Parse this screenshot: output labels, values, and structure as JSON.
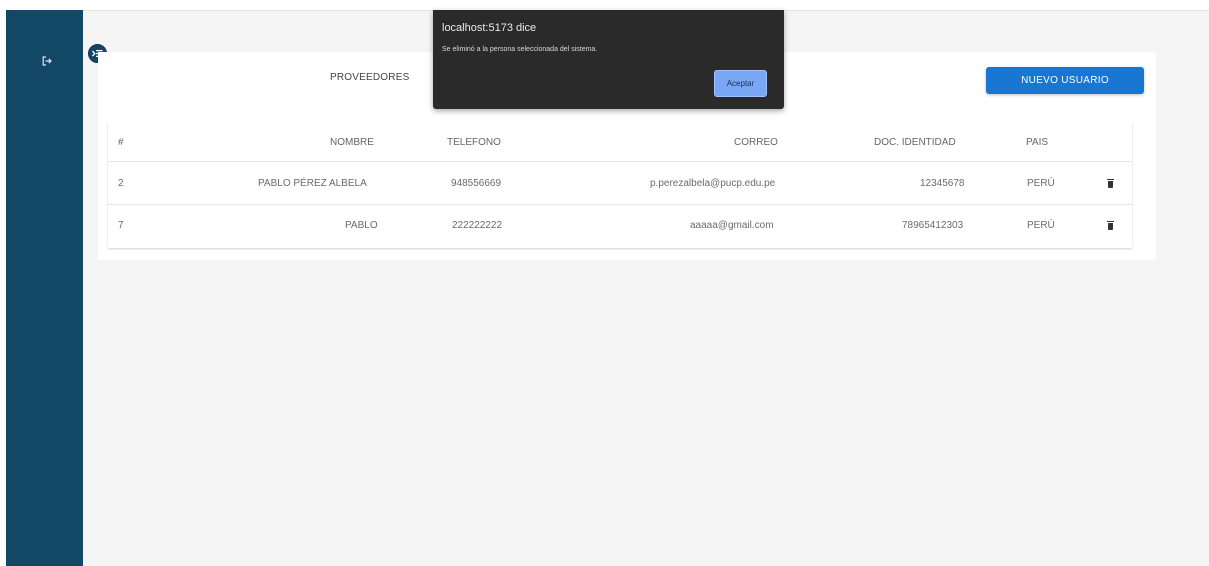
{
  "sidebar": {
    "logout_icon": "logout-icon"
  },
  "header": {
    "toggle_icon": "menu-toggle-icon",
    "tab_label": "PROVEEDORES",
    "new_user_label": "NUEVO USUARIO"
  },
  "table": {
    "headers": [
      "#",
      "NOMBRE",
      "TELEFONO",
      "CORREO",
      "DOC. IDENTIDAD",
      "PAIS"
    ],
    "rows": [
      {
        "id": "2",
        "nombre": "PABLO PÉREZ ALBELA",
        "telefono": "948556669",
        "correo": "p.perezalbela@pucp.edu.pe",
        "doc": "12345678",
        "pais": "PERÚ",
        "action_icon": "trash-icon"
      },
      {
        "id": "7",
        "nombre": "PABLO",
        "telefono": "222222222",
        "correo": "aaaaa@gmail.com",
        "doc": "78965412303",
        "pais": "PERÚ",
        "action_icon": "trash-icon"
      }
    ]
  },
  "dialog": {
    "title": "localhost:5173 dice",
    "message": "Se eliminó a la persona seleccionada del sistema.",
    "ok_label": "Aceptar"
  },
  "colors": {
    "sidebar": "#134766",
    "primary": "#1976d2",
    "dialog_bg": "#2a2a2a",
    "dialog_button": "#7aa7f5"
  }
}
